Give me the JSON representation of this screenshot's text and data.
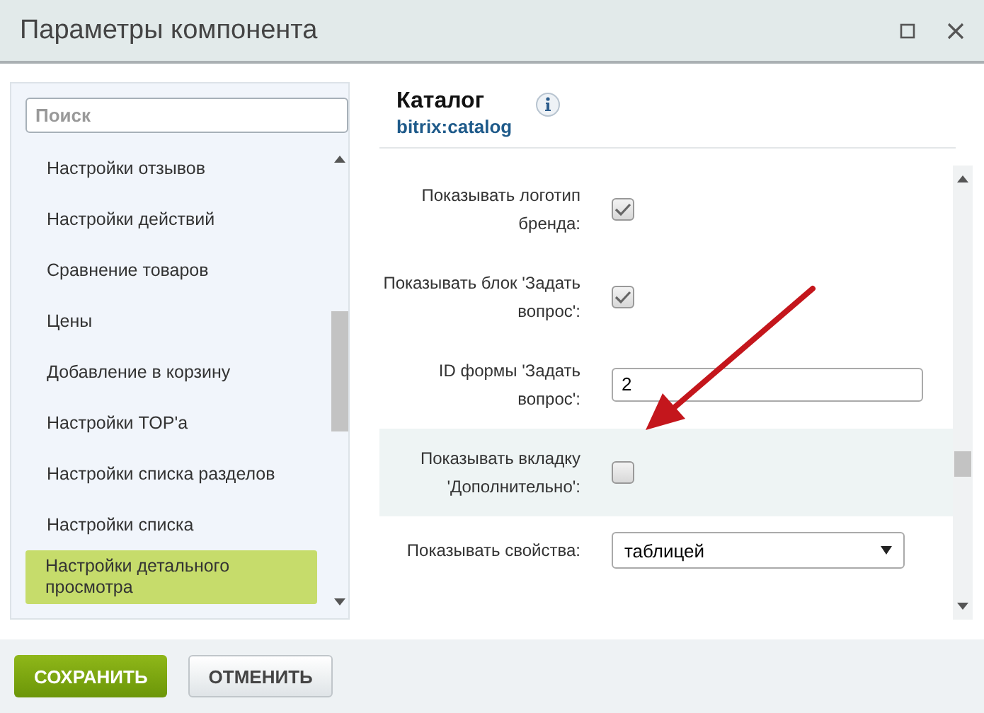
{
  "window": {
    "title": "Параметры компонента"
  },
  "sidebar": {
    "search": {
      "placeholder": "Поиск"
    },
    "items": [
      {
        "label": "Настройки отзывов",
        "selected": false
      },
      {
        "label": "Настройки действий",
        "selected": false
      },
      {
        "label": "Сравнение товаров",
        "selected": false
      },
      {
        "label": "Цены",
        "selected": false
      },
      {
        "label": "Добавление в корзину",
        "selected": false
      },
      {
        "label": "Настройки TOP'а",
        "selected": false
      },
      {
        "label": "Настройки списка разделов",
        "selected": false
      },
      {
        "label": "Настройки списка",
        "selected": false
      },
      {
        "label": "Настройки детального просмотра",
        "selected": true
      }
    ]
  },
  "component": {
    "title": "Каталог",
    "code": "bitrix:catalog"
  },
  "fields": [
    {
      "kind": "checkbox",
      "label": "Показывать логотип бренда:",
      "checked": true,
      "highlighted": false
    },
    {
      "kind": "checkbox",
      "label": "Показывать блок 'Задать вопрос':",
      "checked": true,
      "highlighted": false
    },
    {
      "kind": "text",
      "label": "ID формы 'Задать вопрос':",
      "value": "2",
      "highlighted": false
    },
    {
      "kind": "checkbox",
      "label": "Показывать вкладку 'Дополнительно':",
      "checked": false,
      "highlighted": true
    },
    {
      "kind": "select",
      "label": "Показывать свойства:",
      "value": "таблицей",
      "highlighted": false
    }
  ],
  "buttons": [
    {
      "label": "СОХРАНИТЬ",
      "kind": "primary"
    },
    {
      "label": "ОТМЕНИТЬ",
      "kind": "secondary"
    }
  ]
}
